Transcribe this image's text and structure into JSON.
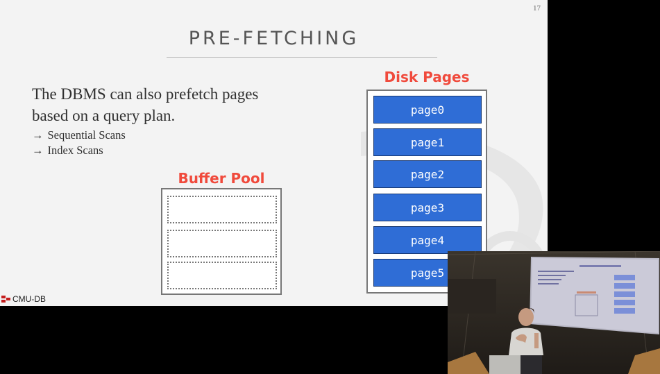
{
  "slide": {
    "page_number": "17",
    "title": "PRE-FETCHING",
    "body": {
      "main": "The DBMS can also prefetch pages based on a query plan.",
      "bullets": [
        "Sequential Scans",
        "Index Scans"
      ],
      "bullet_marker": "→"
    },
    "disk": {
      "label": "Disk Pages",
      "pages": [
        "page0",
        "page1",
        "page2",
        "page3",
        "page4",
        "page5"
      ]
    },
    "buffer_pool": {
      "label": "Buffer Pool",
      "slot_count": 3
    },
    "logo_text": "CMU-DB"
  },
  "colors": {
    "slide_bg": "#f3f3f3",
    "label_red": "#f04a3c",
    "page_blue": "#2f6dd6",
    "page_border": "#16366f",
    "title_gray": "#555555"
  },
  "video_overlay": {
    "description_icon": "presenter-video-icon"
  }
}
